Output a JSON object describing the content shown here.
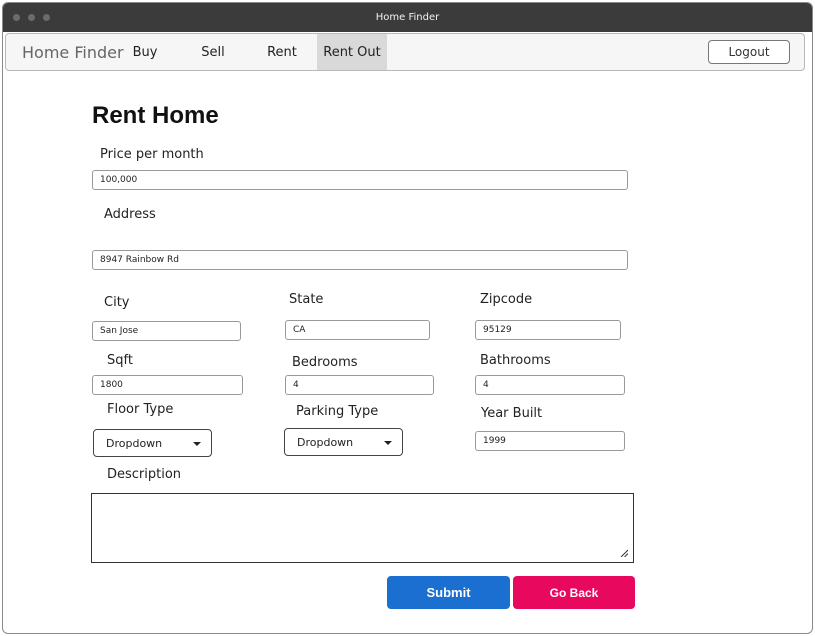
{
  "window": {
    "title": "Home Finder"
  },
  "nav": {
    "brand": "Home Finder",
    "items": [
      {
        "label": "Buy"
      },
      {
        "label": "Sell"
      },
      {
        "label": "Rent"
      },
      {
        "label": "Rent Out",
        "active": true
      }
    ],
    "logout_label": "Logout"
  },
  "form": {
    "title": "Rent Home",
    "price": {
      "label": "Price per month",
      "value": "100,000"
    },
    "address": {
      "label": "Address",
      "value": "8947 Rainbow Rd"
    },
    "city": {
      "label": "City",
      "value": "San Jose"
    },
    "state": {
      "label": "State",
      "value": "CA"
    },
    "zipcode": {
      "label": "Zipcode",
      "value": "95129"
    },
    "sqft": {
      "label": "Sqft",
      "value": "1800"
    },
    "bedrooms": {
      "label": "Bedrooms",
      "value": "4"
    },
    "bathrooms": {
      "label": "Bathrooms",
      "value": "4"
    },
    "floor_type": {
      "label": "Floor Type",
      "value": "Dropdown"
    },
    "parking_type": {
      "label": "Parking Type",
      "value": "Dropdown"
    },
    "year_built": {
      "label": "Year Built",
      "value": "1999"
    },
    "description": {
      "label": "Description",
      "value": ""
    },
    "submit_label": "Submit",
    "back_label": "Go Back"
  },
  "colors": {
    "submit": "#1a6fd1",
    "back": "#e8095f",
    "titlebar": "#3b3b3b"
  }
}
